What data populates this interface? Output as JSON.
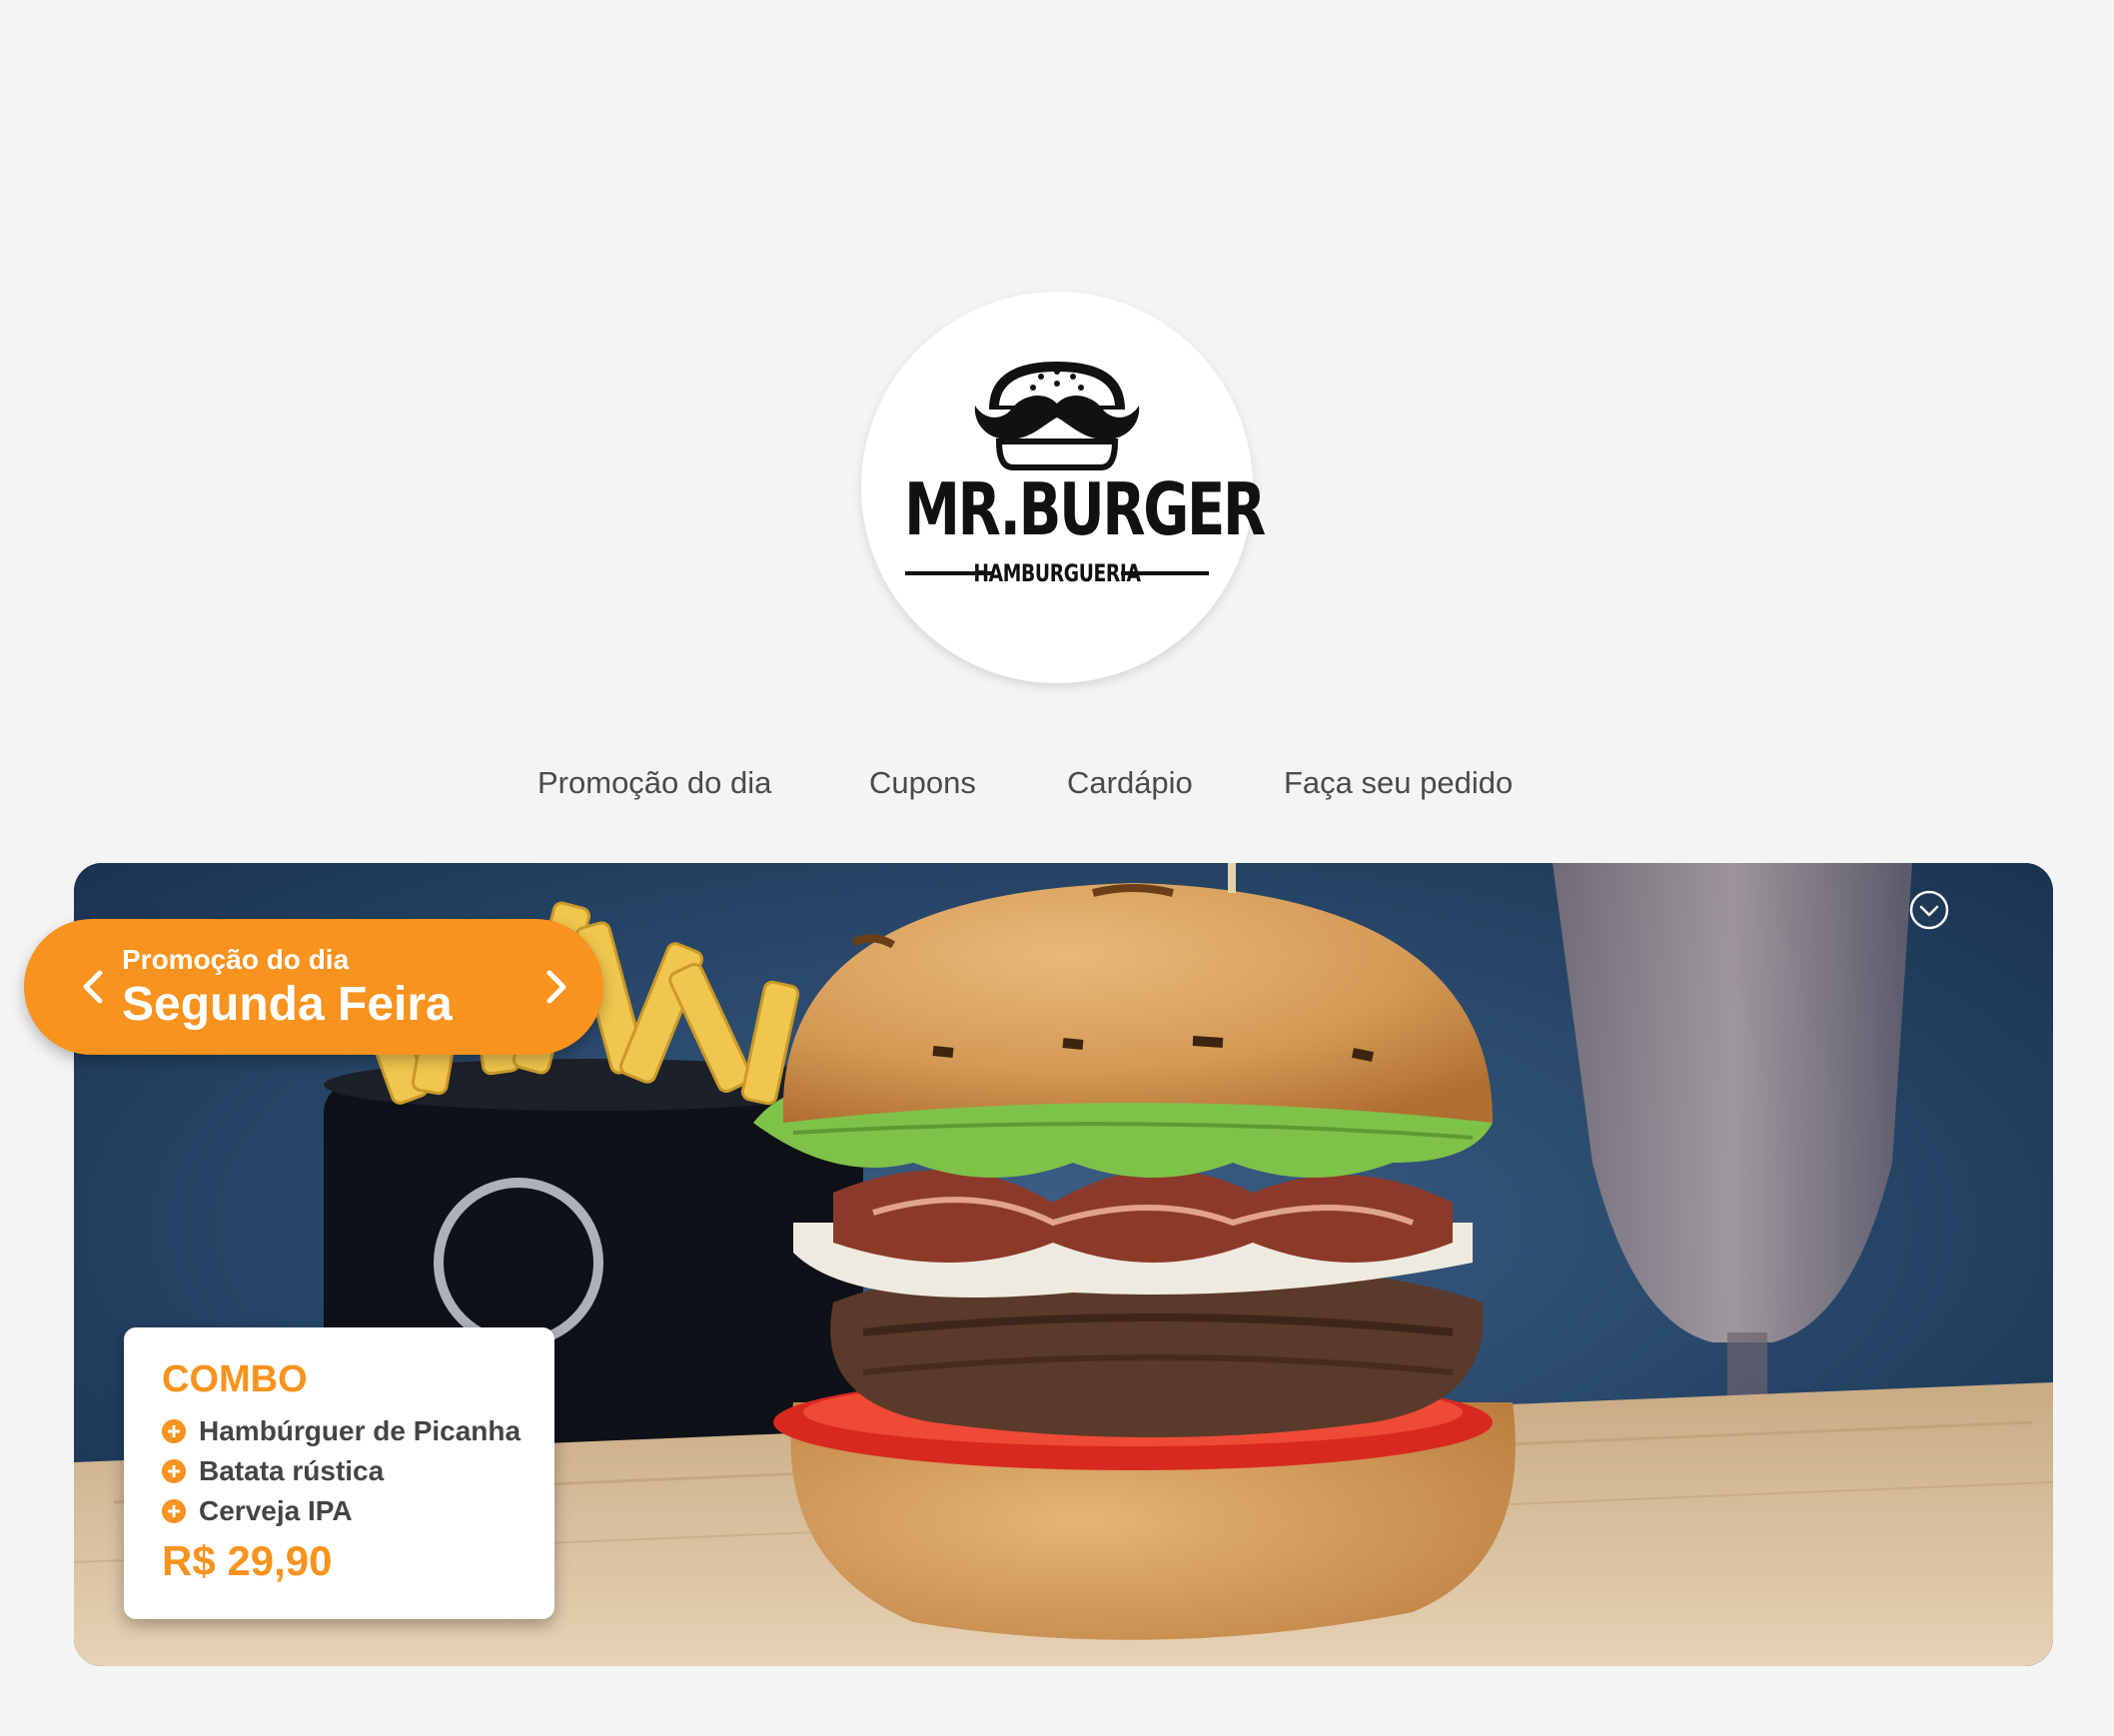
{
  "brand": {
    "name": "MR.BURGER",
    "tagline": "HAMBURGUERIA"
  },
  "nav": {
    "items": [
      {
        "label": "Promoção do dia"
      },
      {
        "label": "Cupons"
      },
      {
        "label": "Cardápio"
      },
      {
        "label": "Faça seu pedido"
      }
    ]
  },
  "promo": {
    "section_label": "Promoção do dia",
    "day": "Segunda Feira",
    "combo": {
      "title": "COMBO",
      "items": [
        {
          "name": "Hambúrguer de Picanha"
        },
        {
          "name": "Batata rústica"
        },
        {
          "name": "Cerveja IPA"
        }
      ],
      "price": "R$ 29,90"
    }
  },
  "icons": {
    "logo": "burger-mustache-logo",
    "prev": "chevron-left-icon",
    "next": "chevron-right-icon",
    "expand": "chevron-down-circle-icon",
    "bullet": "plus-circle-icon"
  },
  "colors": {
    "accent": "#f7931e",
    "background": "#f4f4f4",
    "nav_text": "#4a4a4a",
    "text_dark": "#444444"
  }
}
